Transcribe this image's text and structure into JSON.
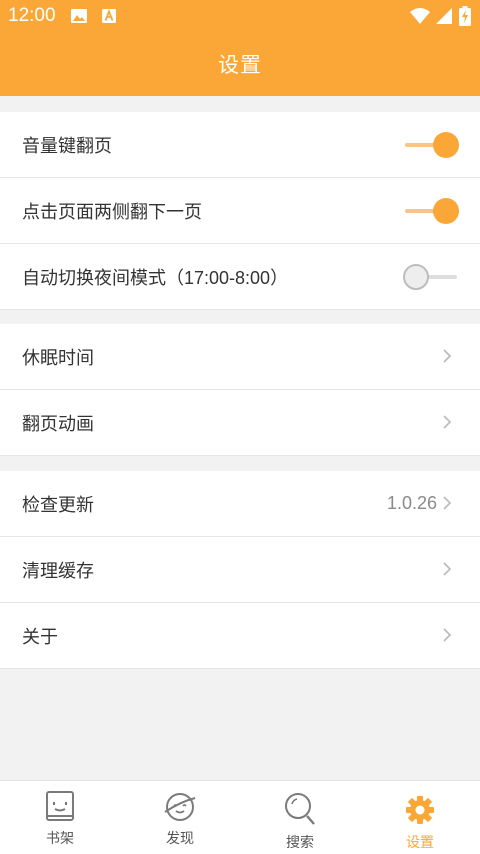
{
  "status_bar": {
    "time": "12:00",
    "icons": [
      "image-notification-icon",
      "a-notification-icon",
      "wifi-icon",
      "signal-icon",
      "battery-charging-icon"
    ]
  },
  "header": {
    "title": "设置"
  },
  "settings": {
    "group1": [
      {
        "label": "音量键翻页",
        "control": "toggle",
        "on": true
      },
      {
        "label": "点击页面两侧翻下一页",
        "control": "toggle",
        "on": true
      },
      {
        "label": "自动切换夜间模式（17:00-8:00）",
        "control": "toggle",
        "on": false
      }
    ],
    "group2": [
      {
        "label": "休眠时间",
        "control": "chevron"
      },
      {
        "label": "翻页动画",
        "control": "chevron"
      }
    ],
    "group3": [
      {
        "label": "检查更新",
        "value": "1.0.26",
        "control": "chevron"
      },
      {
        "label": "清理缓存",
        "control": "chevron"
      },
      {
        "label": "关于",
        "control": "chevron"
      }
    ]
  },
  "bottom_nav": {
    "items": [
      {
        "label": "书架",
        "icon": "bookshelf-icon"
      },
      {
        "label": "发现",
        "icon": "discover-icon"
      },
      {
        "label": "搜索",
        "icon": "search-icon"
      },
      {
        "label": "设置",
        "icon": "settings-gear-icon",
        "active": true
      }
    ]
  },
  "colors": {
    "accent": "#fba737",
    "background": "#f2f2f2",
    "toggle_track_on": "#fbc38a"
  }
}
